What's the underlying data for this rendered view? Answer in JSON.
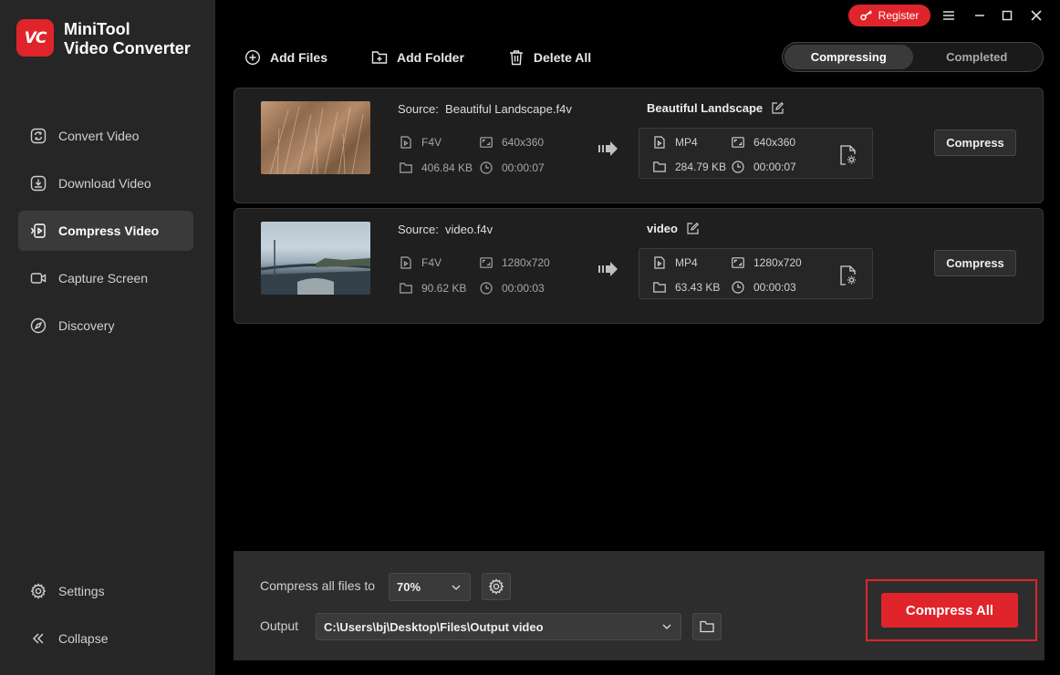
{
  "app": {
    "logo_text": "VC",
    "title_line1": "MiniTool",
    "title_line2": "Video Converter",
    "accent": "#e0242b"
  },
  "topbar": {
    "register_label": "Register"
  },
  "sidebar": {
    "items": [
      {
        "label": "Convert Video",
        "icon": "convert-icon",
        "active": false
      },
      {
        "label": "Download Video",
        "icon": "download-icon",
        "active": false
      },
      {
        "label": "Compress Video",
        "icon": "compress-icon",
        "active": true
      },
      {
        "label": "Capture Screen",
        "icon": "camera-icon",
        "active": false
      },
      {
        "label": "Discovery",
        "icon": "compass-icon",
        "active": false
      }
    ],
    "settings_label": "Settings",
    "collapse_label": "Collapse"
  },
  "toolbar": {
    "add_files": "Add Files",
    "add_folder": "Add Folder",
    "delete_all": "Delete All"
  },
  "tabs": {
    "compressing": "Compressing",
    "completed": "Completed"
  },
  "files": [
    {
      "source_label": "Source:",
      "source_name": "Beautiful Landscape.f4v",
      "src_format": "F4V",
      "src_resolution": "640x360",
      "src_size": "406.84 KB",
      "src_duration": "00:00:07",
      "out_name": "Beautiful Landscape",
      "out_format": "MP4",
      "out_resolution": "640x360",
      "out_size": "284.79 KB",
      "out_duration": "00:00:07",
      "compress_label": "Compress"
    },
    {
      "source_label": "Source:",
      "source_name": "video.f4v",
      "src_format": "F4V",
      "src_resolution": "1280x720",
      "src_size": "90.62 KB",
      "src_duration": "00:00:03",
      "out_name": "video",
      "out_format": "MP4",
      "out_resolution": "1280x720",
      "out_size": "63.43 KB",
      "out_duration": "00:00:03",
      "compress_label": "Compress"
    }
  ],
  "bottom": {
    "compress_all_to_label": "Compress all files to",
    "compress_value": "70%",
    "output_label": "Output",
    "output_path": "C:\\Users\\bj\\Desktop\\Files\\Output video",
    "compress_all_label": "Compress All"
  }
}
